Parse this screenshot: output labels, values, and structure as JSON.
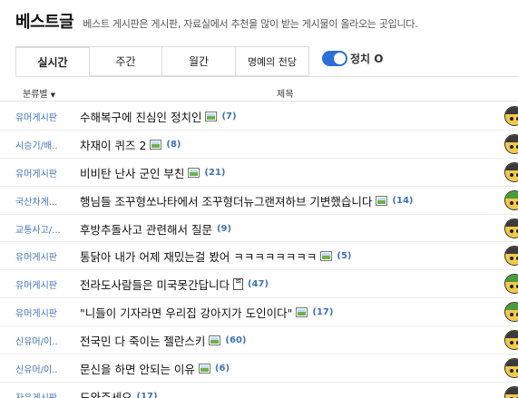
{
  "header": {
    "title": "베스트글",
    "description": "베스트 게시판은 게시판, 자료실에서 추천을 많이 받는 게시물이 올라오는 곳입니다."
  },
  "tabs": [
    {
      "label": "실시간",
      "active": true
    },
    {
      "label": "주간",
      "active": false
    },
    {
      "label": "월간",
      "active": false
    },
    {
      "label": "명예의 전당",
      "active": false
    }
  ],
  "politics_toggle": {
    "label": "정치 O",
    "on": true
  },
  "table": {
    "col_category": "분류별",
    "col_title": "제목"
  },
  "rows": [
    {
      "category": "유머게시판",
      "title": "수해복구에 진심인 정치인",
      "icon": "image-icon",
      "count": "(7)"
    },
    {
      "category": "시승기/배..",
      "title": "차재이 퀴즈 2",
      "icon": "image-icon",
      "count": "(8)"
    },
    {
      "category": "유머게시판",
      "title": "비비탄 난사 군인 부친",
      "icon": "image-icon",
      "count": "(21)"
    },
    {
      "category": "국산차게...",
      "title": "행님들 조꾸형쏘나타에서 조꾸형더뉴그랜져하브 기변했습니다",
      "icon": "image-icon",
      "count": "(14)"
    },
    {
      "category": "교통사고/...",
      "title": "후방추돌사고 관련해서 질문",
      "icon": "",
      "count": "(9)"
    },
    {
      "category": "유머게시판",
      "title": "통닭아 내가 어제 재밌는걸 봤어 ㅋㅋㅋㅋㅋㅋㅋㅋ",
      "icon": "image-icon",
      "count": "(5)"
    },
    {
      "category": "유머게시판",
      "title": "전라도사람들은 미국못간답니다",
      "icon": "file-icon",
      "count": "(47)"
    },
    {
      "category": "유머게시판",
      "title": "\"니들이 기자라면 우리집 강아지가 도인이다\"",
      "icon": "image-icon",
      "count": "(17)"
    },
    {
      "category": "신유머/이..",
      "title": "전국민 다 죽이는 젤란스키",
      "icon": "image-icon",
      "count": "(60)"
    },
    {
      "category": "신유머/이..",
      "title": "문신을 하면 안되는 이유",
      "icon": "image-icon",
      "count": "(6)"
    },
    {
      "category": "자유게시판",
      "title": "도와주세요",
      "icon": "",
      "count": "(17)"
    }
  ],
  "colors": {
    "link_blue": "#3f72b7",
    "toggle_blue": "#2d6fd6"
  }
}
